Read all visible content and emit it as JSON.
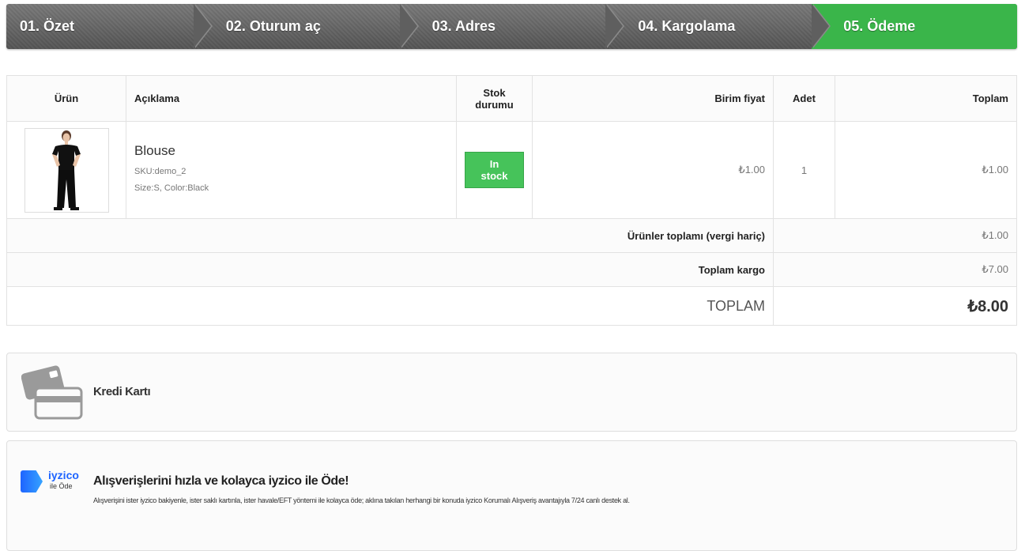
{
  "steps": [
    {
      "label": "01. Özet"
    },
    {
      "label": "02. Oturum aç"
    },
    {
      "label": "03. Adres"
    },
    {
      "label": "04. Kargolama"
    },
    {
      "label": "05. Ödeme"
    }
  ],
  "colors": {
    "active_step": "#3ab54a",
    "in_stock": "#46c35a",
    "iyzico_blue": "#1e64ff"
  },
  "cart": {
    "headers": {
      "product": "Ürün",
      "description": "Açıklama",
      "stock": "Stok durumu",
      "unit_price": "Birim fiyat",
      "qty": "Adet",
      "total": "Toplam"
    },
    "items": [
      {
        "name": "Blouse",
        "sku": "SKU:demo_2",
        "attributes": "Size:S, Color:Black",
        "stock": "In stock",
        "unit_price": "₺1.00",
        "qty": "1",
        "total": "₺1.00",
        "image_icon": "product-photo-blouse"
      }
    ],
    "summary": {
      "products_label": "Ürünler toplamı (vergi hariç)",
      "products_value": "₺1.00",
      "shipping_label": "Toplam kargo",
      "shipping_value": "₺7.00",
      "total_label": "TOPLAM",
      "total_value": "₺8.00"
    }
  },
  "payment": {
    "credit_card": {
      "label": "Kredi Kartı",
      "icon": "credit-card-icon"
    },
    "iyzico": {
      "logo_word": "iyzico",
      "logo_sub": "ile Öde",
      "title": "Alışverişlerini hızla ve kolayca iyzico ile Öde!",
      "description": "Alışverişini ister iyzico bakiyenle, ister saklı kartınla, ister havale/EFT yöntemi ile kolayca öde; aklına takılan herhangi bir konuda iyzico Korumalı Alışveriş avantajıyla 7/24 canlı destek al."
    }
  }
}
